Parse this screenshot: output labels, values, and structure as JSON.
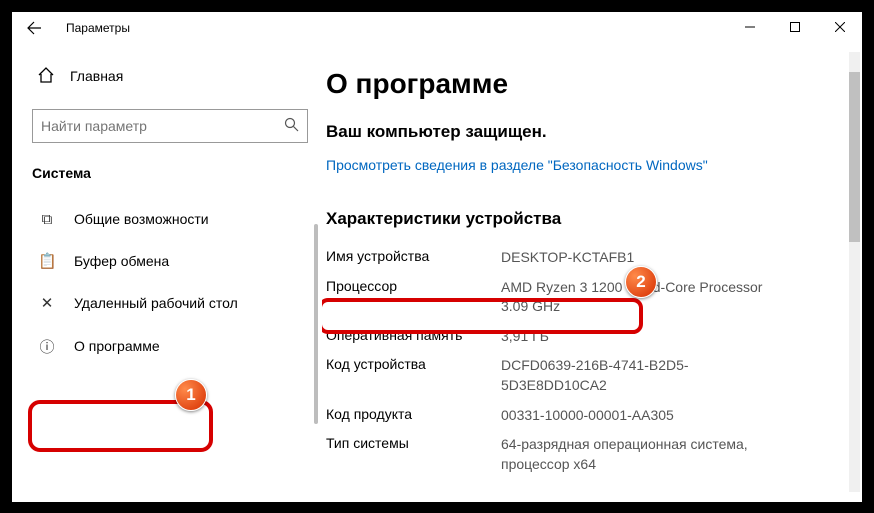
{
  "titlebar": {
    "title": "Параметры"
  },
  "sidebar": {
    "home": "Главная",
    "search_placeholder": "Найти параметр",
    "section": "Система",
    "cutoff_line": ". . . . . . . . . . . . . . . . . . . . . . . . . . . . . . . . . .",
    "items": [
      {
        "icon": "⧉",
        "label": "Общие возможности"
      },
      {
        "icon": "📋",
        "label": "Буфер обмена"
      },
      {
        "icon": "✕",
        "label": "Удаленный рабочий стол"
      },
      {
        "icon": "ⓘ",
        "label": "О программе"
      }
    ]
  },
  "main": {
    "heading": "О программе",
    "protected": "Ваш компьютер защищен.",
    "security_link": "Просмотреть сведения в разделе \"Безопасность Windows\"",
    "spec_heading": "Характеристики устройства",
    "specs": [
      {
        "label": "Имя устройства",
        "value": "DESKTOP-KCTAFB1"
      },
      {
        "label": "Процессор",
        "value": "AMD Ryzen 3 1200 Quad-Core Processor 3.09 GHz"
      },
      {
        "label": "Оперативная память",
        "value": "3,91 ГБ"
      },
      {
        "label": "Код устройства",
        "value": "DCFD0639-216B-4741-B2D5-5D3E8DD10CA2"
      },
      {
        "label": "Код продукта",
        "value": "00331-10000-00001-AA305"
      },
      {
        "label": "Тип системы",
        "value": "64-разрядная операционная система, процессор x64"
      }
    ]
  },
  "callouts": {
    "one": "1",
    "two": "2"
  }
}
